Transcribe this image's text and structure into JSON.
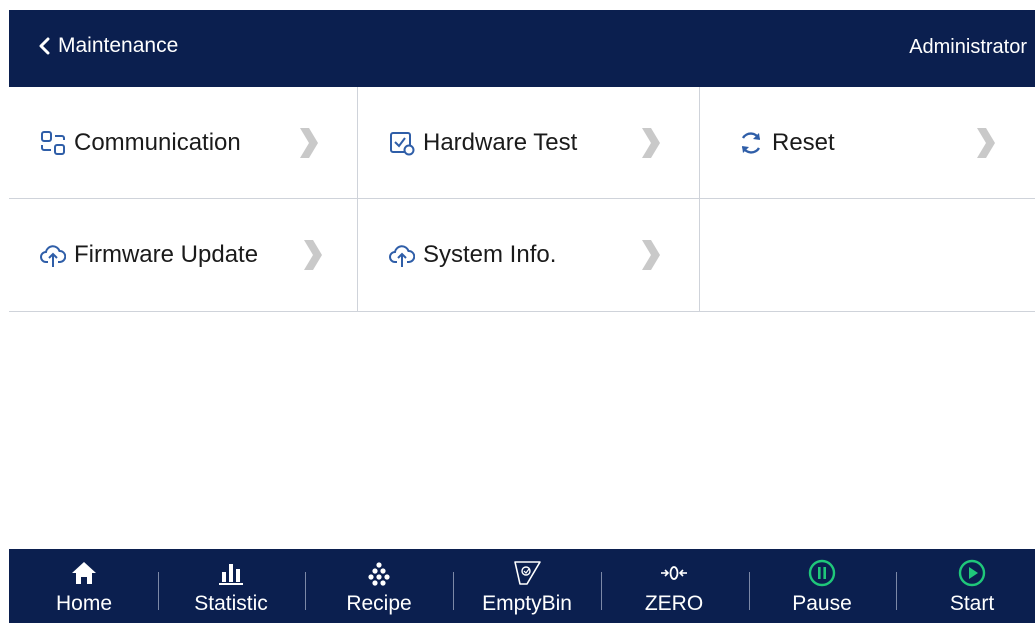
{
  "header": {
    "back_label": "Maintenance",
    "user_label": "Administrator",
    "background": "#0b1f4f"
  },
  "menu": {
    "items": [
      {
        "label": "Communication",
        "icon": "communication-icon"
      },
      {
        "label": "Hardware Test",
        "icon": "hardware-test-icon"
      },
      {
        "label": "Reset",
        "icon": "reset-icon"
      },
      {
        "label": "Firmware Update",
        "icon": "cloud-upload-icon"
      },
      {
        "label": "System Info.",
        "icon": "cloud-upload-icon"
      }
    ]
  },
  "footer": {
    "buttons": [
      {
        "label": "Home",
        "icon": "home-icon"
      },
      {
        "label": "Statistic",
        "icon": "statistic-icon"
      },
      {
        "label": "Recipe",
        "icon": "recipe-icon"
      },
      {
        "label": "EmptyBin",
        "icon": "empty-bin-icon"
      },
      {
        "label": "ZERO",
        "icon": "zero-icon"
      },
      {
        "label": "Pause",
        "icon": "pause-icon",
        "color": "#1fc77a"
      },
      {
        "label": "Start",
        "icon": "start-icon",
        "color": "#1fc77a"
      }
    ]
  }
}
